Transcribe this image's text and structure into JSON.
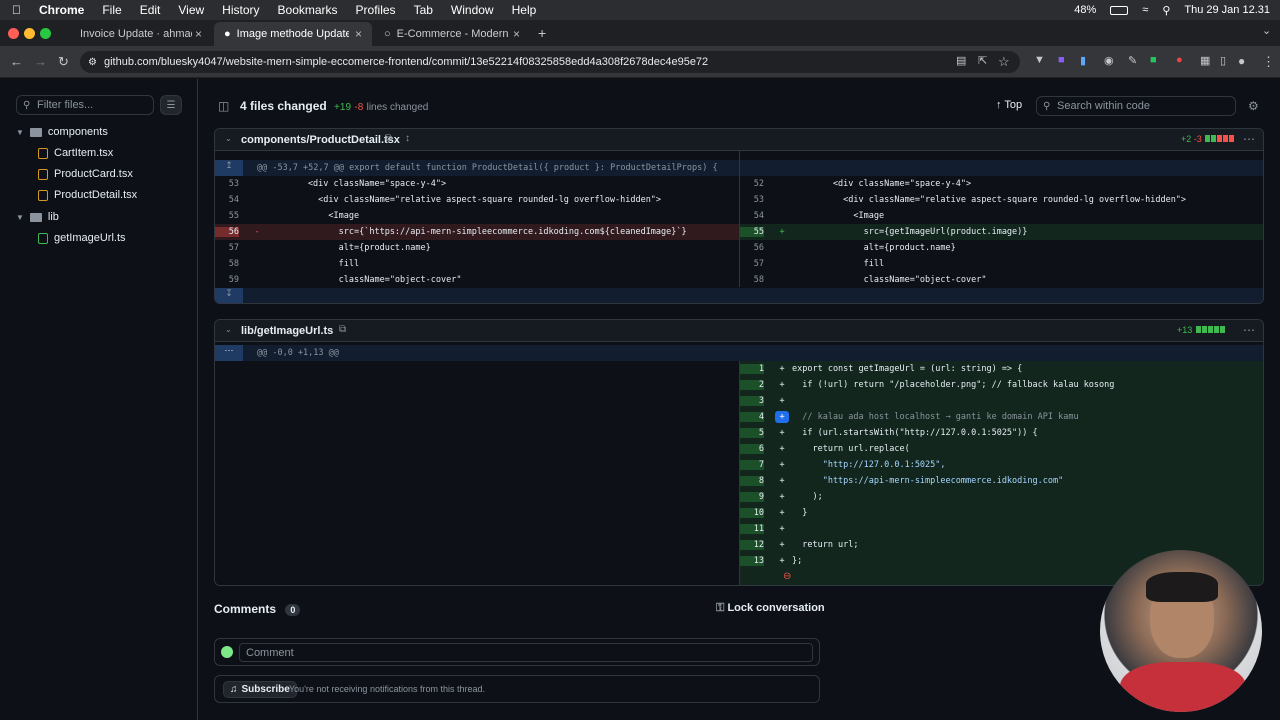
{
  "menubar": {
    "app": "Chrome",
    "items": [
      "File",
      "Edit",
      "View",
      "History",
      "Bookmarks",
      "Profiles",
      "Tab",
      "Window",
      "Help"
    ],
    "battery": "48%",
    "clock": "Thu 29 Jan  12.31"
  },
  "tabs": [
    {
      "title": "Invoice Update · ahmadhafid"
    },
    {
      "title": "Image methode Update · blu"
    },
    {
      "title": "E-Commerce - Modern E-con"
    }
  ],
  "address": {
    "url": "github.com/bluesky4047/website-mern-simple-eccomerce-frontend/commit/13e52214f08325858edd4a308f2678dec4e95e72"
  },
  "sidebar": {
    "filter_placeholder": "Filter files...",
    "items": [
      {
        "label": "components"
      },
      {
        "label": "CartItem.tsx"
      },
      {
        "label": "ProductCard.tsx"
      },
      {
        "label": "ProductDetail.tsx"
      },
      {
        "label": "lib"
      },
      {
        "label": "getImageUrl.ts"
      }
    ]
  },
  "header": {
    "files_changed": "4 files changed",
    "additions": "+19",
    "deletions": "-8",
    "lines_changed": "lines changed",
    "top_label": "Top",
    "search_placeholder": "Search within code"
  },
  "file1": {
    "name": "components/ProductDetail.tsx",
    "add": "+2",
    "del": "-3",
    "hunk": "@@ -53,7 +52,7 @@ export default function ProductDetail({ product }: ProductDetailProps) {",
    "left_rows": [
      {
        "ln": "53",
        "code": "        <div className=\"space-y-4\">"
      },
      {
        "ln": "54",
        "code": "          <div className=\"relative aspect-square rounded-lg overflow-hidden\">"
      },
      {
        "ln": "55",
        "code": "            <Image"
      },
      {
        "ln": "56",
        "code": "              src={`https://api-mern-simpleecommerce.idkoding.com${cleanedImage}`}",
        "type": "del"
      },
      {
        "ln": "57",
        "code": "              alt={product.name}"
      },
      {
        "ln": "58",
        "code": "              fill"
      },
      {
        "ln": "59",
        "code": "              className=\"object-cover\""
      }
    ],
    "right_rows": [
      {
        "ln": "52",
        "code": "        <div className=\"space-y-4\">"
      },
      {
        "ln": "53",
        "code": "          <div className=\"relative aspect-square rounded-lg overflow-hidden\">"
      },
      {
        "ln": "54",
        "code": "            <Image"
      },
      {
        "ln": "55",
        "code": "              src={getImageUrl(product.image)}",
        "type": "add"
      },
      {
        "ln": "56",
        "code": "              alt={product.name}"
      },
      {
        "ln": "57",
        "code": "              fill"
      },
      {
        "ln": "58",
        "code": "              className=\"object-cover\""
      }
    ]
  },
  "file2": {
    "name": "lib/getImageUrl.ts",
    "add": "+13",
    "hunk": "@@ -0,0 +1,13 @@",
    "rows": [
      {
        "ln": "1",
        "code": "export const getImageUrl = (url: string) => {"
      },
      {
        "ln": "2",
        "code": "  if (!url) return \"/placeholder.png\"; // fallback kalau kosong"
      },
      {
        "ln": "3",
        "code": ""
      },
      {
        "ln": "4",
        "code": "  // kalau ada host localhost → ganti ke domain API kamu"
      },
      {
        "ln": "5",
        "code": "  if (url.startsWith(\"http://127.0.0.1:5025\")) {"
      },
      {
        "ln": "6",
        "code": "    return url.replace("
      },
      {
        "ln": "7",
        "code": "      \"http://127.0.0.1:5025\","
      },
      {
        "ln": "8",
        "code": "      \"https://api-mern-simpleecommerce.idkoding.com\""
      },
      {
        "ln": "9",
        "code": "    );"
      },
      {
        "ln": "10",
        "code": "  }"
      },
      {
        "ln": "11",
        "code": ""
      },
      {
        "ln": "12",
        "code": "  return url;"
      },
      {
        "ln": "13",
        "code": "};"
      }
    ]
  },
  "comments": {
    "title": "Comments",
    "count": "0",
    "lock_label": "Lock conversation",
    "comment_placeholder": "Comment",
    "subscribe_label": "Subscribe",
    "notification_text": "You're not receiving notifications from this thread."
  },
  "colors": {
    "add": "#3fb950",
    "del": "#f85149",
    "bg": "#0d1117",
    "border": "#30363d"
  }
}
